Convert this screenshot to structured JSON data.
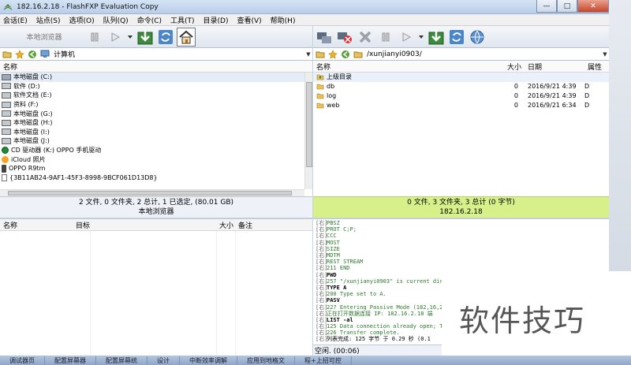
{
  "window": {
    "title": "182.16.2.18 - FlashFXP Evaluation Copy",
    "min": "—",
    "max": "□",
    "close": "✕"
  },
  "menu": [
    "会话(E)",
    "站点(S)",
    "选项(O)",
    "队列(Q)",
    "命令(C)",
    "工具(T)",
    "目录(D)",
    "查看(V)",
    "帮助(H)"
  ],
  "left_toolbar": {
    "label": "本地浏览器"
  },
  "left_address": {
    "path": "计算机"
  },
  "right_address": {
    "path": "/xunjianyi0903/"
  },
  "left_columns": {
    "name": "名称"
  },
  "drives": [
    "本地磁盘 (C:)",
    "软件 (D:)",
    "软件文档 (E:)",
    "资料 (F:)",
    "本地磁盘 (G:)",
    "本地磁盘 (H:)",
    "本地磁盘 (I:)",
    "本地磁盘 (J:)",
    "CD 驱动器 (K:) OPPO 手机驱动",
    "iCloud 照片",
    "OPPO R9tm",
    "{3B11AB24-9AF1-45F3-8998-9BCF061D13D8}"
  ],
  "right_columns": {
    "name": "名称",
    "size": "大小",
    "date": "日期",
    "attr": "属性"
  },
  "remote_up": "上级目录",
  "remote_files": [
    {
      "name": "db",
      "size": "0",
      "date": "2016/9/21 4:39",
      "attr": "D"
    },
    {
      "name": "log",
      "size": "0",
      "date": "2016/9/21 4:39",
      "attr": "D"
    },
    {
      "name": "web",
      "size": "0",
      "date": "2016/9/21 6:34",
      "attr": "D"
    }
  ],
  "left_status": {
    "line1": "2 文件, 0 文件夹, 2 总计, 1 已选定, (80.01 GB)",
    "line2": "本地浏览器"
  },
  "right_status": {
    "line1": "0 文件, 3 文件夹, 3 总计 (0 字节)",
    "line2": "182.16.2.18"
  },
  "queue_columns": {
    "name": "名称",
    "target": "目标",
    "size": "大小",
    "note": "备注"
  },
  "log": [
    {
      "tag": "[右]",
      "text": " PBSZ",
      "kind": "reply"
    },
    {
      "tag": "[右]",
      "text": " PROT C;P;",
      "kind": "reply"
    },
    {
      "tag": "[右]",
      "text": " CCC",
      "kind": "reply"
    },
    {
      "tag": "[右]",
      "text": " MOST",
      "kind": "reply"
    },
    {
      "tag": "[右]",
      "text": " SIZE",
      "kind": "reply"
    },
    {
      "tag": "[右]",
      "text": " MDTM",
      "kind": "reply"
    },
    {
      "tag": "[右]",
      "text": " REST STREAM",
      "kind": "reply"
    },
    {
      "tag": "[右]",
      "text": "211 END",
      "kind": "reply"
    },
    {
      "tag": "[右]",
      "text": "PWD",
      "kind": "cmd"
    },
    {
      "tag": "[右]",
      "text": "257 \"/xunjianyi0903\" is current dir",
      "kind": "reply"
    },
    {
      "tag": "[右]",
      "text": "TYPE A",
      "kind": "cmd"
    },
    {
      "tag": "[右]",
      "text": "200 Type set to A.",
      "kind": "reply"
    },
    {
      "tag": "[右]",
      "text": "PASV",
      "kind": "cmd"
    },
    {
      "tag": "[右]",
      "text": "227 Entering Passive Mode (182,16,2",
      "kind": "reply"
    },
    {
      "tag": "[右]",
      "text": "正在打开数据连接 IP: 182.16.2.18 端",
      "kind": "reply"
    },
    {
      "tag": "[右]",
      "text": "LIST -al",
      "kind": "cmd"
    },
    {
      "tag": "[右]",
      "text": "125 Data connection already open; T",
      "kind": "reply"
    },
    {
      "tag": "[右]",
      "text": "226 Transfer complete.",
      "kind": "reply"
    },
    {
      "tag": "[右]",
      "text": "列表完成: 125 字节 于 0.29 秒 (0.1",
      "kind": "status-msg"
    }
  ],
  "log_status": "空闲. (00:06)",
  "taskbar": [
    "调试器页",
    "配置屏幕器",
    "配置屏幕统",
    "设计",
    "中断效率调解",
    "应用到地格文",
    "程+上招可控"
  ],
  "watermark": "软件技巧"
}
